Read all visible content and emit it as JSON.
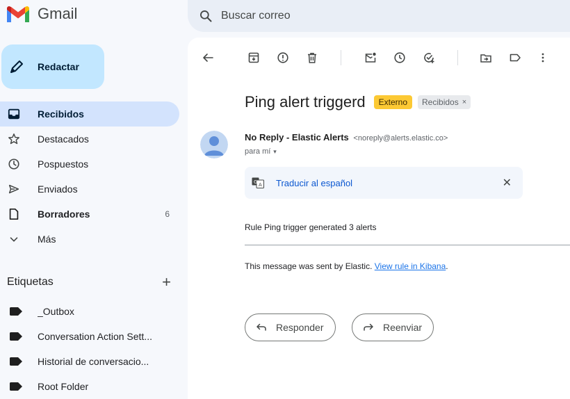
{
  "app": {
    "name": "Gmail",
    "colors": {
      "accent": "#0b57d0",
      "compose_bg": "#c2e7ff",
      "active_nav": "#d3e3fd",
      "external_chip": "#fcc934"
    }
  },
  "search": {
    "placeholder": "Buscar correo",
    "icon": "search-icon"
  },
  "compose": {
    "label": "Redactar",
    "icon": "pencil-icon"
  },
  "nav": {
    "items": [
      {
        "label": "Recibidos",
        "icon": "inbox-icon",
        "active": true
      },
      {
        "label": "Destacados",
        "icon": "star-icon"
      },
      {
        "label": "Pospuestos",
        "icon": "clock-icon"
      },
      {
        "label": "Enviados",
        "icon": "send-icon"
      },
      {
        "label": "Borradores",
        "icon": "draft-icon",
        "count": "6"
      },
      {
        "label": "Más",
        "icon": "chevron-down-icon"
      }
    ]
  },
  "labels": {
    "title": "Etiquetas",
    "add_symbol": "+",
    "items": [
      {
        "label": "_Outbox"
      },
      {
        "label": "Conversation Action Sett..."
      },
      {
        "label": "Historial de conversacio..."
      },
      {
        "label": "Root Folder"
      }
    ]
  },
  "toolbar": {
    "icons": [
      "back-arrow-icon",
      "archive-icon",
      "report-spam-icon",
      "delete-icon",
      "mark-unread-icon",
      "snooze-icon",
      "add-task-icon",
      "move-to-icon",
      "label-icon",
      "more-vert-icon"
    ]
  },
  "email": {
    "subject": "Ping alert triggerd",
    "chip_external": "Externo",
    "chip_inbox": "Recibidos",
    "chip_inbox_close": "×",
    "sender_name": "No Reply - Elastic Alerts",
    "sender_email": "<noreply@alerts.elastic.co>",
    "to": "para mí",
    "to_caret": "▾",
    "translate_label": "Traducir al español",
    "translate_close": "✕",
    "body_line1": "Rule Ping trigger generated 3 alerts",
    "body_line2_prefix": "This message was sent by Elastic. ",
    "body_link": "View rule in Kibana",
    "body_line2_suffix": "."
  },
  "actions": {
    "reply": "Responder",
    "forward": "Reenviar"
  }
}
